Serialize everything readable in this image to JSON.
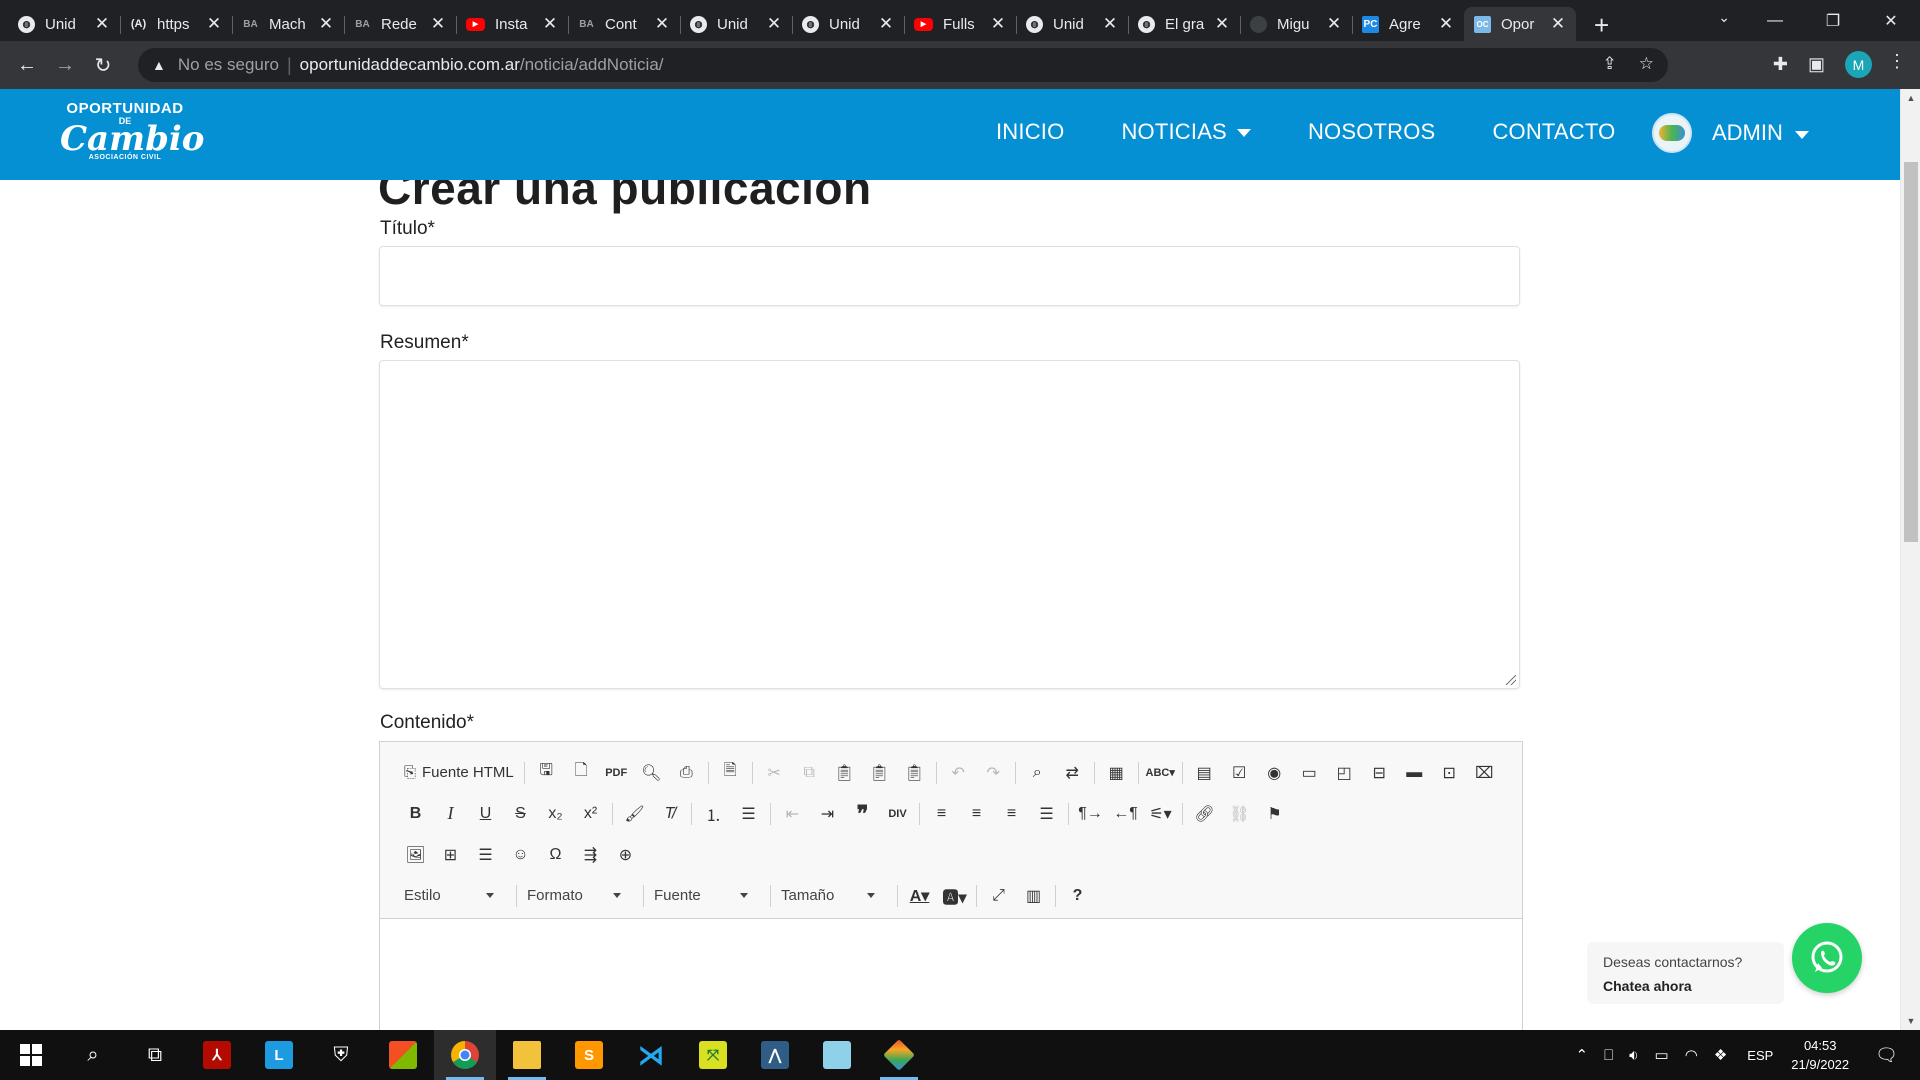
{
  "browser": {
    "tabs": [
      {
        "favicon": "globe-icon",
        "title": "Unid"
      },
      {
        "favicon": "ai-icon",
        "title": "https"
      },
      {
        "favicon": "ba-icon",
        "title": "Mach"
      },
      {
        "favicon": "ba-icon",
        "title": "Rede"
      },
      {
        "favicon": "youtube-icon",
        "title": "Insta"
      },
      {
        "favicon": "ba-icon",
        "title": "Cont"
      },
      {
        "favicon": "globe-icon",
        "title": "Unid"
      },
      {
        "favicon": "globe-icon",
        "title": "Unid"
      },
      {
        "favicon": "youtube-icon",
        "title": "Fulls"
      },
      {
        "favicon": "globe-icon",
        "title": "Unid"
      },
      {
        "favicon": "globe-icon",
        "title": "El gra"
      },
      {
        "favicon": "github-icon",
        "title": "Migu"
      },
      {
        "favicon": "pc-icon",
        "title": "Agre"
      },
      {
        "favicon": "oportunidad-icon",
        "title": "Opor",
        "active": true
      }
    ],
    "security_label": "No es seguro",
    "url_host": "oportunidaddecambio.com.ar",
    "url_path": "/noticia/addNoticia/",
    "profile_initial": "M"
  },
  "site": {
    "logo_top": "OPORTUNIDAD",
    "logo_de": "DE",
    "logo_main": "Cambio",
    "logo_sub": "ASOCIACIÓN CIVIL",
    "nav": {
      "inicio": "INICIO",
      "noticias": "NOTICIAS",
      "nosotros": "NOSOTROS",
      "contacto": "CONTACTO",
      "admin": "ADMIN"
    },
    "header_color": "#0690d4"
  },
  "form": {
    "page_title": "Crear una publicación",
    "titulo_label": "Título*",
    "titulo_value": "",
    "resumen_label": "Resumen*",
    "resumen_value": "",
    "contenido_label": "Contenido*"
  },
  "editor": {
    "source_label": "Fuente HTML",
    "combos": {
      "estilo": "Estilo",
      "formato": "Formato",
      "fuente": "Fuente",
      "tamano": "Tamaño"
    }
  },
  "chat": {
    "question": "Deseas contactarnos?",
    "cta": "Chatea ahora",
    "color": "#25d366"
  },
  "taskbar": {
    "language": "ESP",
    "time": "04:53",
    "date": "21/9/2022"
  }
}
